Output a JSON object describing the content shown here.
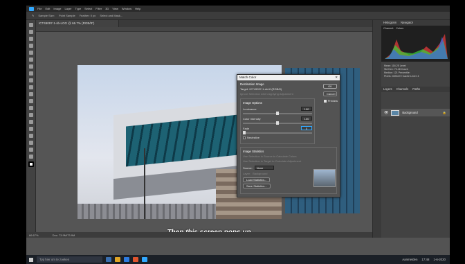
{
  "app": {
    "menu": [
      "File",
      "Edit",
      "Image",
      "Layer",
      "Type",
      "Select",
      "Filter",
      "3D",
      "View",
      "Window",
      "Help"
    ]
  },
  "options_bar": {
    "tool": "Sample Size:",
    "sample": "Point Sample",
    "feather": "Feather: 0 px",
    "refine": "Select and Mask..."
  },
  "document": {
    "tab": "ICT49097-1-sb-LOG @ 66.7% (RGB/8*)"
  },
  "dialog": {
    "title": "Match Color",
    "destination_heading": "Destination Image",
    "target": "Target: ICT49097-1-sb.tif (RGB/8)",
    "ignore_selection": "Ignore Selection when Applying Adjustment",
    "options_heading": "Image Options",
    "luminance_label": "Luminance",
    "luminance_value": "100",
    "color_intensity_label": "Color Intensity",
    "color_intensity_value": "100",
    "fade_label": "Fade",
    "fade_value": "0",
    "neutralize_label": "Neutralize",
    "stats_heading": "Image Statistics",
    "use_sel_source": "Use Selection in Source to Calculate Colors",
    "use_sel_target": "Use Selection in Target to Calculate Adjustment",
    "source_label": "Source:",
    "source_value": "None",
    "layer_label": "Layer:",
    "layer_value": "Background",
    "load_stats": "Load Statistics...",
    "save_stats": "Save Statistics...",
    "ok": "OK",
    "cancel": "Cancel",
    "preview": "Preview"
  },
  "caption": "Then this screen pops up",
  "status": {
    "zoom": "66.67%",
    "doc": "Doc: 73.9M/73.9M"
  },
  "panels": {
    "histogram_tab": "Histogram",
    "navigator_tab": "Navigator",
    "channel_label": "Channel:",
    "channel_value": "Colors",
    "layers_tab": "Layers",
    "channels_tab": "Channels",
    "paths_tab": "Paths",
    "layer_name": "Background",
    "info_lines": [
      "Mean: 116.25    Level:",
      "Std Dev: 70.48   Count:",
      "Median: 121      Percentile:",
      "Pixels: 4694272   Cache Level: 4"
    ]
  },
  "taskbar": {
    "search": "Typ hier om te zoeken",
    "lang": "Aanmelden",
    "time": "17:48",
    "date": "1-6-2020"
  },
  "colors": {
    "ps_bg": "#535353",
    "accent": "#31a8ff"
  }
}
